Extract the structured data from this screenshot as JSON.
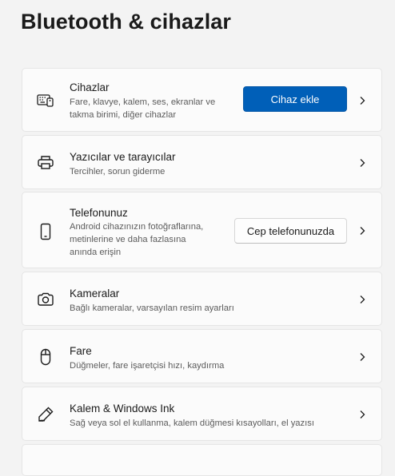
{
  "page": {
    "title": "Bluetooth & cihazlar"
  },
  "cards": [
    {
      "id": "cihazlar",
      "title": "Cihazlar",
      "desc_lines": [
        "Fare, klavye, kalem, ses, ekranlar ve",
        "takma birimi, diğer cihazlar"
      ],
      "button": "Cihaz ekle",
      "icon": "devices-icon"
    },
    {
      "id": "yazicilar",
      "title": "Yazıcılar ve tarayıcılar",
      "desc_lines": [
        "Tercihler, sorun giderme"
      ],
      "icon": "printer-icon"
    },
    {
      "id": "telefon",
      "title": "Telefonunuz",
      "desc_lines": [
        "Android cihazınızın fotoğraflarına,",
        "metinlerine ve daha fazlasına",
        "anında erişin"
      ],
      "button": "Cep telefonunuzda",
      "icon": "phone-icon"
    },
    {
      "id": "kameralar",
      "title": "Kameralar",
      "desc_lines": [
        "Bağlı kameralar, varsayılan resim ayarları"
      ],
      "icon": "camera-icon"
    },
    {
      "id": "fare",
      "title": "Fare",
      "desc_lines": [
        "Düğmeler, fare işaretçisi hızı, kaydırma"
      ],
      "icon": "mouse-icon"
    },
    {
      "id": "kalem",
      "title": "Kalem & Windows Ink",
      "desc_lines": [
        "Sağ veya sol el kullanma, kalem düğmesi kısayolları, el yazısı"
      ],
      "icon": "pen-icon"
    }
  ],
  "colors": {
    "accent": "#005fb8",
    "background": "#f3f3f3",
    "card": "#fbfbfb"
  }
}
